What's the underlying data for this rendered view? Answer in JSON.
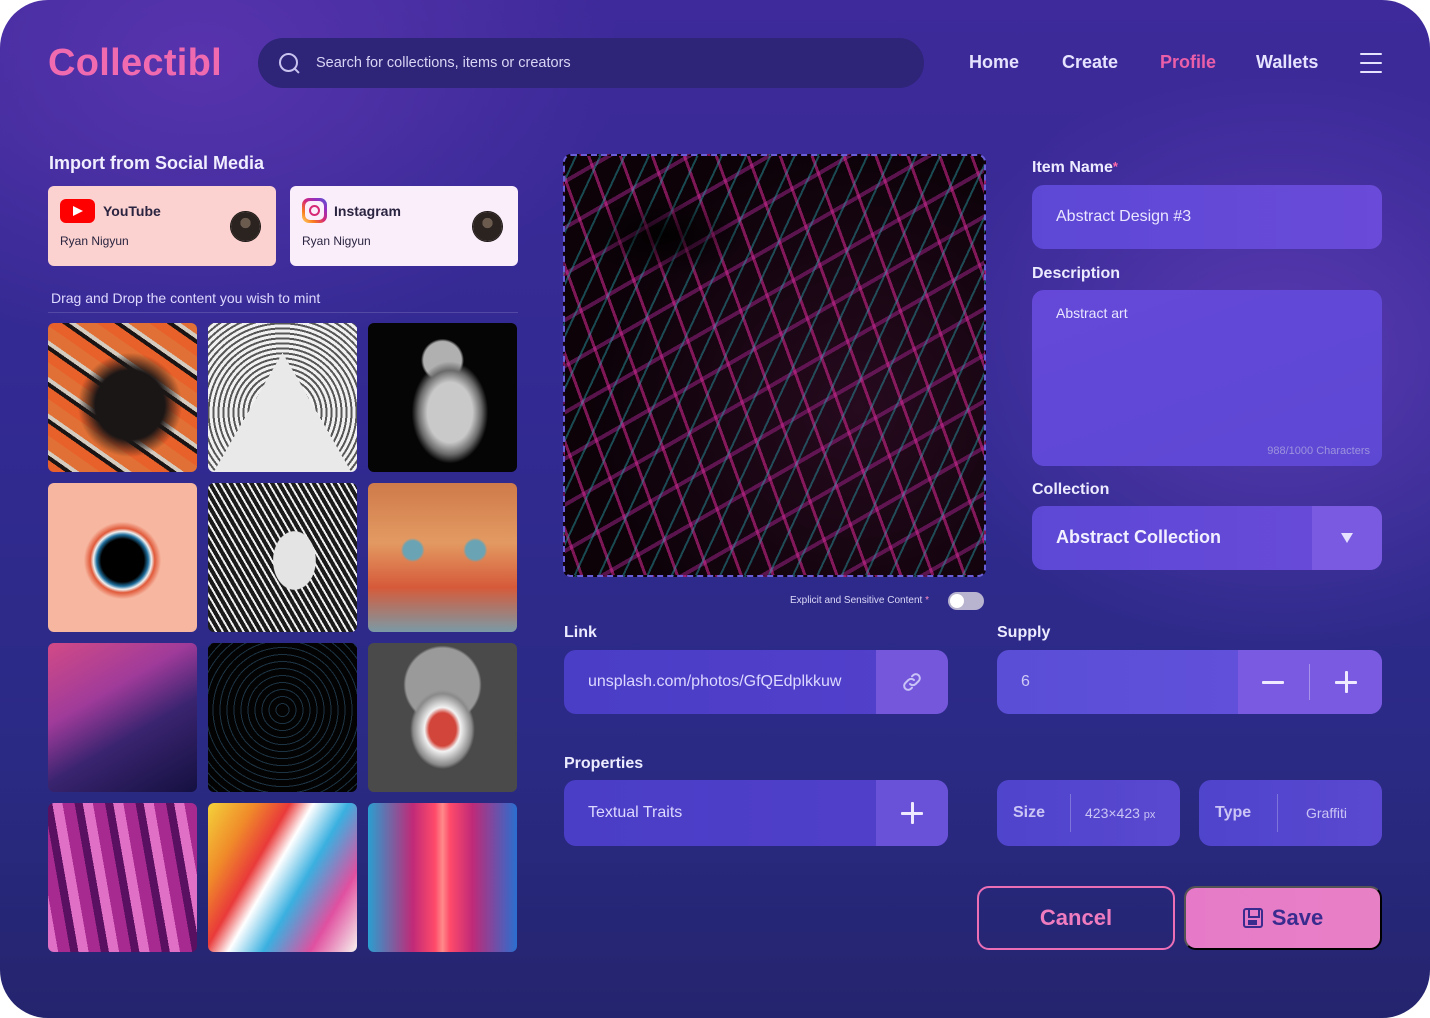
{
  "app": {
    "logo": "Collectibl"
  },
  "search": {
    "placeholder": "Search for collections, items or creators"
  },
  "nav": {
    "items": [
      "Home",
      "Create",
      "Profile",
      "Wallets"
    ],
    "active": "Profile"
  },
  "social": {
    "title": "Import from Social Media",
    "cards": [
      {
        "platform": "YouTube",
        "user": "Ryan Nigyun",
        "icon": "youtube-icon"
      },
      {
        "platform": "Instagram",
        "user": "Ryan Nigyun",
        "icon": "instagram-icon"
      }
    ]
  },
  "gallery": {
    "instruction": "Drag and Drop the content you wish to mint",
    "items": [
      "graffiti cat",
      "all-seeing eye",
      "statue",
      "black hole",
      "woman engraving",
      "painted face",
      "neon corner",
      "dark pattern",
      "collage head",
      "purple swirl",
      "abstract paint",
      "neon corridor"
    ]
  },
  "preview": {
    "explicit_label": "Explicit and Sensitive Content",
    "explicit_required": "*",
    "explicit_on": false
  },
  "form": {
    "item_name": {
      "label": "Item Name",
      "required": "*",
      "value": "Abstract Design #3"
    },
    "description": {
      "label": "Description",
      "value": "Abstract art",
      "count": "988/1000 Characters"
    },
    "collection": {
      "label": "Collection",
      "value": "Abstract Collection"
    },
    "link": {
      "label": "Link",
      "value": "unsplash.com/photos/GfQEdplkkuw"
    },
    "supply": {
      "label": "Supply",
      "value": "6"
    },
    "properties": {
      "label": "Properties",
      "placeholder": "Textual Traits",
      "size": {
        "key": "Size",
        "value": "423×423",
        "unit": "px"
      },
      "type": {
        "key": "Type",
        "value": "Graffiti"
      }
    }
  },
  "actions": {
    "cancel": "Cancel",
    "save": "Save"
  },
  "colors": {
    "accent": "#ea5fa8",
    "background": "#322a92",
    "field": "#5d48d6"
  }
}
